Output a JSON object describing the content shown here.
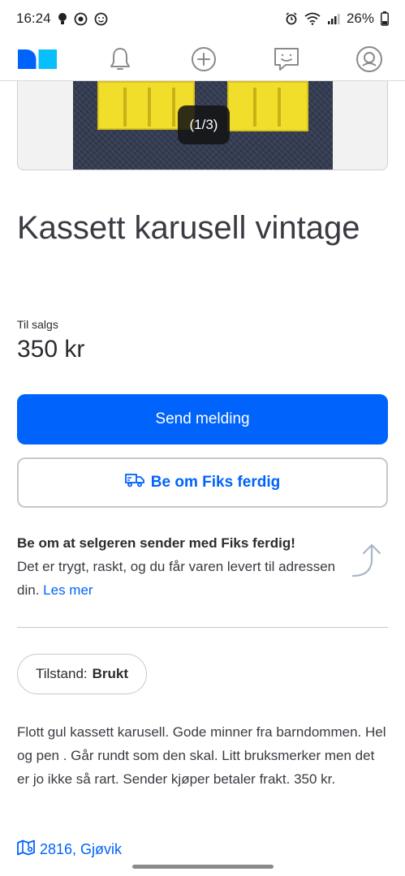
{
  "status_bar": {
    "time": "16:24",
    "battery": "26%",
    "icons_left": [
      "bulb-icon",
      "focus-icon",
      "smiley-icon"
    ],
    "icons_right": [
      "alarm-icon",
      "wifi-icon",
      "signal-icon"
    ]
  },
  "nav": {
    "items": [
      {
        "name": "logo",
        "icon": "finn-logo"
      },
      {
        "name": "notifications",
        "icon": "bell-icon"
      },
      {
        "name": "new-ad",
        "icon": "plus-circle-icon"
      },
      {
        "name": "messages",
        "icon": "chat-icon"
      },
      {
        "name": "profile",
        "icon": "profile-icon"
      }
    ]
  },
  "gallery": {
    "counter": "(1/3)"
  },
  "listing": {
    "title": "Kassett karusell vintage",
    "sale_label": "Til salgs",
    "price": "350 kr"
  },
  "actions": {
    "send_message": "Send melding",
    "fiks_ferdig": "Be om Fiks ferdig"
  },
  "fiks_info": {
    "heading": "Be om at selgeren sender med Fiks ferdig!",
    "text": "Det er trygt, raskt, og du får varen levert til adressen din.",
    "link": "Les mer"
  },
  "condition": {
    "label": "Tilstand:",
    "value": "Brukt"
  },
  "description": "Flott gul kassett karusell. Gode minner fra barndommen. Hel og pen . Går rundt som den skal. Litt bruksmerker men det er jo ikke så rart. Sender kjøper betaler frakt. 350 kr.",
  "location": "2816, Gjøvik",
  "colors": {
    "accent": "#0063fb",
    "logo_dark": "#0063fb",
    "logo_light": "#06bffc"
  }
}
